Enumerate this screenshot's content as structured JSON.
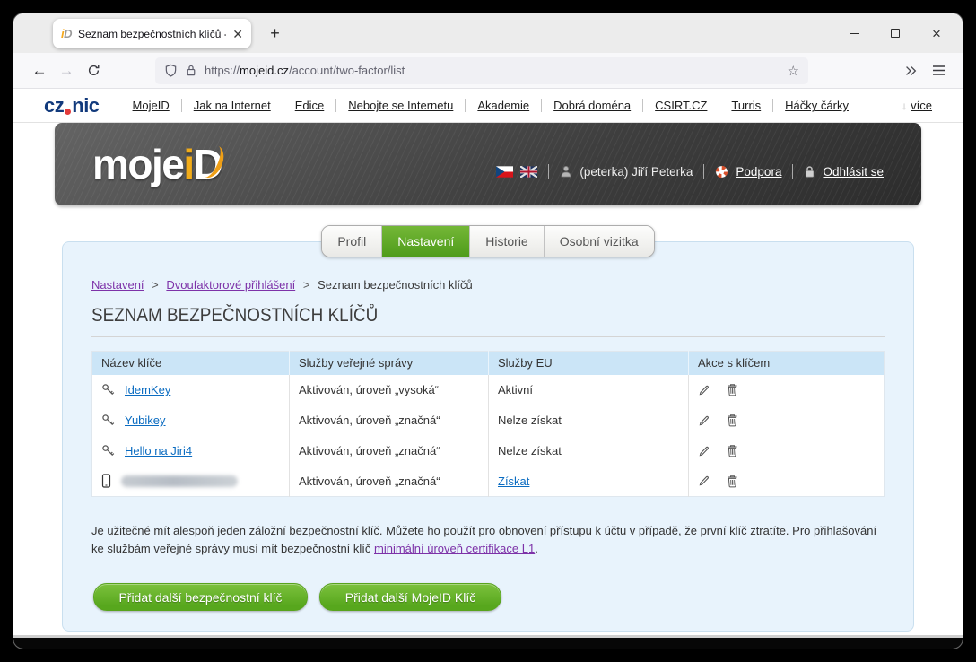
{
  "browser": {
    "tab_title": "Seznam bezpečnostních klíčů -",
    "url_scheme": "https://",
    "url_domain": "mojeid.cz",
    "url_path": "/account/two-factor/list"
  },
  "site_nav": {
    "logo_cz": "cz",
    "logo_nic": "nic",
    "items": [
      "MojeID",
      "Jak na Internet",
      "Edice",
      "Nebojte se Internetu",
      "Akademie",
      "Dobrá doména",
      "CSIRT.CZ",
      "Turris",
      "Háčky čárky"
    ],
    "more_label": "více"
  },
  "masthead": {
    "logo_moje": "moje",
    "logo_i": "i",
    "logo_d": "D",
    "user_name": "(peterka) Jiří Peterka",
    "support_label": "Podpora",
    "logout_label": "Odhlásit se"
  },
  "site_tabs": {
    "items": [
      "Profil",
      "Nastavení",
      "Historie",
      "Osobní vizitka"
    ],
    "active": "Nastavení"
  },
  "breadcrumb": {
    "level1": "Nastavení",
    "level2": "Dvoufaktorové přihlášení",
    "current": "Seznam bezpečnostních klíčů",
    "separator": ">"
  },
  "content": {
    "heading": "SEZNAM BEZPEČNOSTNÍCH KLÍČŮ",
    "note_before_link": "Je užitečné mít alespoň jeden záložní bezpečnostní klíč. Můžete ho použít pro obnovení přístupu k účtu v případě, že první klíč ztratíte. Pro přihlašování ke službám veřejné správy musí mít bezpečnostní klíč ",
    "note_link": "minimální úroveň certifikace L1",
    "note_after_link": ".",
    "add_security_key_label": "Přidat další bezpečnostní klíč",
    "add_mojeid_key_label": "Přidat další MojeID Klíč"
  },
  "keys_table": {
    "headers": [
      "Název klíče",
      "Služby veřejné správy",
      "Služby EU",
      "Akce s klíčem"
    ],
    "rows": [
      {
        "icon": "key-icon",
        "name": "IdemKey",
        "name_redacted": false,
        "gov_services": "Aktivován, úroveň „vysoká“",
        "eu_services": "Aktivní",
        "eu_is_link": false
      },
      {
        "icon": "key-icon",
        "name": "Yubikey",
        "name_redacted": false,
        "gov_services": "Aktivován, úroveň „značná“",
        "eu_services": "Nelze získat",
        "eu_is_link": false
      },
      {
        "icon": "key-icon",
        "name": "Hello na Jiri4",
        "name_redacted": false,
        "gov_services": "Aktivován, úroveň „značná“",
        "eu_services": "Nelze získat",
        "eu_is_link": false
      },
      {
        "icon": "phone-icon",
        "name": "",
        "name_redacted": true,
        "gov_services": "Aktivován, úroveň „značná“",
        "eu_services": "Získat",
        "eu_is_link": true
      }
    ]
  },
  "icons": {
    "favicon": "mojeid-id",
    "new_tab": "plus",
    "minimize": "minimize",
    "maximize": "maximize",
    "close": "close",
    "back": "arrow-left",
    "forward": "arrow-right",
    "reload": "reload",
    "tracking": "shield",
    "secure": "padlock",
    "bookmark": "star",
    "overflow": "double-chevron",
    "app_menu": "hamburger",
    "language_cz": "czech-flag",
    "language_en": "uk-flag",
    "account": "person",
    "support": "life-ring",
    "logout": "padlock",
    "edit": "pencil",
    "delete": "trash",
    "security_key": "key",
    "mobile_key": "mobile-phone",
    "more": "arrow-down"
  },
  "colors": {
    "accent_green": "#5fa81f",
    "link_blue": "#0b6cc1",
    "link_purple": "#7d32a8",
    "panel_bg": "#e8f3fc",
    "table_header_bg": "#cbe5f7",
    "masthead_dark": "#3e3e3e",
    "cznic_blue": "#123a7c",
    "logo_yellow": "#f2ac19"
  }
}
